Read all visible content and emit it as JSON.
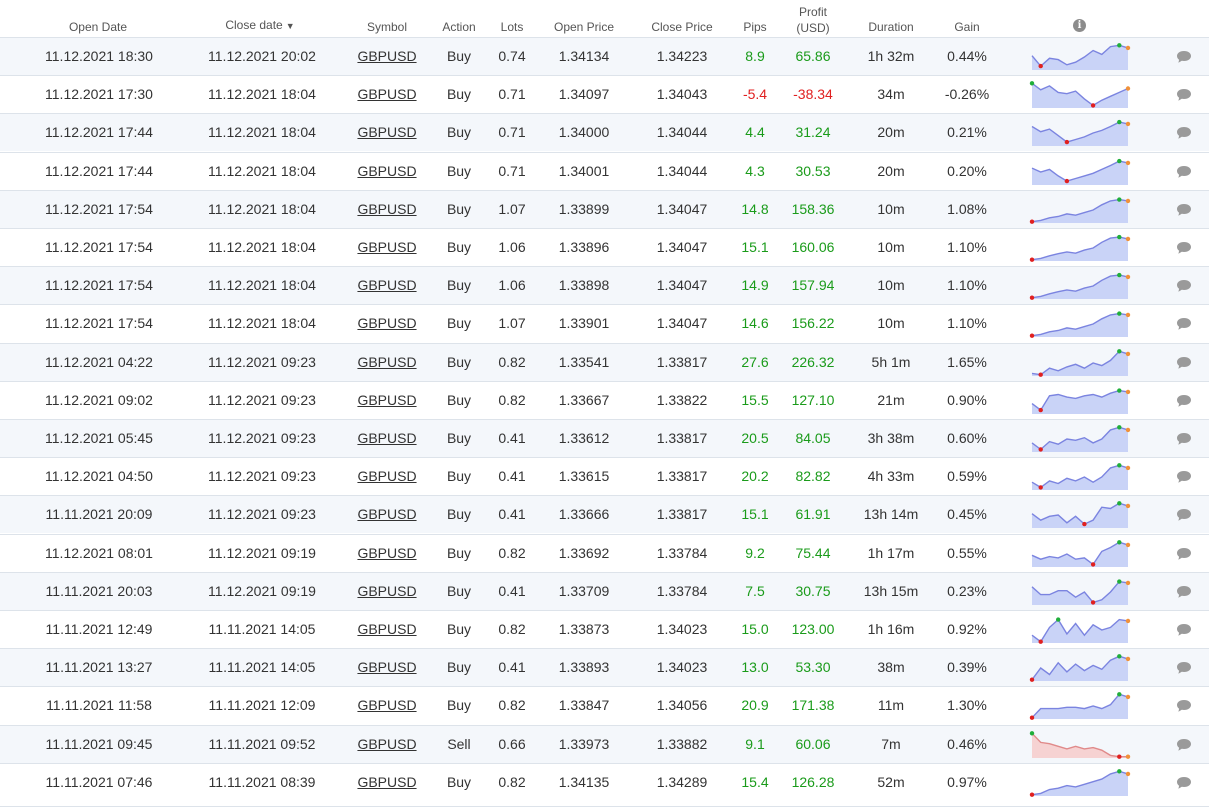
{
  "header": {
    "open_date": "Open Date",
    "close_date": "Close date",
    "sort_arrow": "▼",
    "symbol": "Symbol",
    "action": "Action",
    "lots": "Lots",
    "open_price": "Open Price",
    "close_price": "Close Price",
    "pips": "Pips",
    "profit_line1": "Profit",
    "profit_line2": "(USD)",
    "duration": "Duration",
    "gain": "Gain",
    "info_icon": "i"
  },
  "colors": {
    "positive": "#1a9b1a",
    "negative": "#e02020",
    "spark_line_up": "#7b84e0",
    "spark_fill_up": "#c9d3f7",
    "spark_line_down": "#e08a8a",
    "spark_fill_down": "#f6d2d2",
    "marker_start": "#e02020",
    "marker_max": "#1fae3a",
    "marker_end": "#f0913a"
  },
  "trades": [
    {
      "open_date": "11.12.2021 18:30",
      "close_date": "11.12.2021 20:02",
      "symbol": "GBPUSD",
      "action": "Buy",
      "lots": "0.74",
      "open_price": "1.34134",
      "close_price": "1.34223",
      "pips": "8.9",
      "profit": "65.86",
      "duration": "1h 32m",
      "gain": "0.44%",
      "spark": [
        0.55,
        0.15,
        0.45,
        0.4,
        0.2,
        0.3,
        0.5,
        0.75,
        0.6,
        0.9,
        0.95,
        0.85
      ]
    },
    {
      "open_date": "11.12.2021 17:30",
      "close_date": "11.12.2021 18:04",
      "symbol": "GBPUSD",
      "action": "Buy",
      "lots": "0.71",
      "open_price": "1.34097",
      "close_price": "1.34043",
      "pips": "-5.4",
      "profit": "-38.34",
      "duration": "34m",
      "gain": "-0.26%",
      "spark": [
        0.95,
        0.7,
        0.85,
        0.6,
        0.55,
        0.65,
        0.35,
        0.1,
        0.3,
        0.45,
        0.6,
        0.75
      ]
    },
    {
      "open_date": "11.12.2021 17:44",
      "close_date": "11.12.2021 18:04",
      "symbol": "GBPUSD",
      "action": "Buy",
      "lots": "0.71",
      "open_price": "1.34000",
      "close_price": "1.34044",
      "pips": "4.4",
      "profit": "31.24",
      "duration": "20m",
      "gain": "0.21%",
      "spark": [
        0.75,
        0.55,
        0.65,
        0.4,
        0.15,
        0.25,
        0.35,
        0.5,
        0.6,
        0.75,
        0.92,
        0.85
      ]
    },
    {
      "open_date": "11.12.2021 17:44",
      "close_date": "11.12.2021 18:04",
      "symbol": "GBPUSD",
      "action": "Buy",
      "lots": "0.71",
      "open_price": "1.34001",
      "close_price": "1.34044",
      "pips": "4.3",
      "profit": "30.53",
      "duration": "20m",
      "gain": "0.20%",
      "spark": [
        0.65,
        0.5,
        0.6,
        0.35,
        0.15,
        0.25,
        0.35,
        0.45,
        0.6,
        0.75,
        0.92,
        0.85
      ]
    },
    {
      "open_date": "11.12.2021 17:54",
      "close_date": "11.12.2021 18:04",
      "symbol": "GBPUSD",
      "action": "Buy",
      "lots": "1.07",
      "open_price": "1.33899",
      "close_price": "1.34047",
      "pips": "14.8",
      "profit": "158.36",
      "duration": "10m",
      "gain": "1.08%",
      "spark": [
        0.05,
        0.1,
        0.2,
        0.25,
        0.35,
        0.3,
        0.4,
        0.5,
        0.7,
        0.85,
        0.9,
        0.85
      ]
    },
    {
      "open_date": "11.12.2021 17:54",
      "close_date": "11.12.2021 18:04",
      "symbol": "GBPUSD",
      "action": "Buy",
      "lots": "1.06",
      "open_price": "1.33896",
      "close_price": "1.34047",
      "pips": "15.1",
      "profit": "160.06",
      "duration": "10m",
      "gain": "1.10%",
      "spark": [
        0.05,
        0.1,
        0.2,
        0.28,
        0.35,
        0.3,
        0.42,
        0.5,
        0.72,
        0.88,
        0.92,
        0.85
      ]
    },
    {
      "open_date": "11.12.2021 17:54",
      "close_date": "11.12.2021 18:04",
      "symbol": "GBPUSD",
      "action": "Buy",
      "lots": "1.06",
      "open_price": "1.33898",
      "close_price": "1.34047",
      "pips": "14.9",
      "profit": "157.94",
      "duration": "10m",
      "gain": "1.10%",
      "spark": [
        0.05,
        0.1,
        0.2,
        0.28,
        0.35,
        0.3,
        0.42,
        0.5,
        0.72,
        0.88,
        0.92,
        0.85
      ]
    },
    {
      "open_date": "11.12.2021 17:54",
      "close_date": "11.12.2021 18:04",
      "symbol": "GBPUSD",
      "action": "Buy",
      "lots": "1.07",
      "open_price": "1.33901",
      "close_price": "1.34047",
      "pips": "14.6",
      "profit": "156.22",
      "duration": "10m",
      "gain": "1.10%",
      "spark": [
        0.05,
        0.1,
        0.2,
        0.25,
        0.35,
        0.3,
        0.4,
        0.5,
        0.7,
        0.85,
        0.9,
        0.85
      ]
    },
    {
      "open_date": "11.12.2021 04:22",
      "close_date": "11.12.2021 09:23",
      "symbol": "GBPUSD",
      "action": "Buy",
      "lots": "0.82",
      "open_price": "1.33541",
      "close_price": "1.33817",
      "pips": "27.6",
      "profit": "226.32",
      "duration": "5h 1m",
      "gain": "1.65%",
      "spark": [
        0.1,
        0.05,
        0.3,
        0.2,
        0.35,
        0.45,
        0.3,
        0.5,
        0.4,
        0.6,
        0.95,
        0.85
      ]
    },
    {
      "open_date": "11.12.2021 09:02",
      "close_date": "11.12.2021 09:23",
      "symbol": "GBPUSD",
      "action": "Buy",
      "lots": "0.82",
      "open_price": "1.33667",
      "close_price": "1.33822",
      "pips": "15.5",
      "profit": "127.10",
      "duration": "21m",
      "gain": "0.90%",
      "spark": [
        0.4,
        0.15,
        0.7,
        0.75,
        0.65,
        0.6,
        0.7,
        0.75,
        0.65,
        0.8,
        0.9,
        0.85
      ]
    },
    {
      "open_date": "11.12.2021 05:45",
      "close_date": "11.12.2021 09:23",
      "symbol": "GBPUSD",
      "action": "Buy",
      "lots": "0.41",
      "open_price": "1.33612",
      "close_price": "1.33817",
      "pips": "20.5",
      "profit": "84.05",
      "duration": "3h 38m",
      "gain": "0.60%",
      "spark": [
        0.35,
        0.1,
        0.4,
        0.3,
        0.5,
        0.45,
        0.55,
        0.35,
        0.5,
        0.85,
        0.95,
        0.85
      ]
    },
    {
      "open_date": "11.12.2021 04:50",
      "close_date": "11.12.2021 09:23",
      "symbol": "GBPUSD",
      "action": "Buy",
      "lots": "0.41",
      "open_price": "1.33615",
      "close_price": "1.33817",
      "pips": "20.2",
      "profit": "82.82",
      "duration": "4h 33m",
      "gain": "0.59%",
      "spark": [
        0.3,
        0.1,
        0.35,
        0.25,
        0.45,
        0.35,
        0.5,
        0.3,
        0.5,
        0.85,
        0.95,
        0.85
      ]
    },
    {
      "open_date": "11.11.2021 20:09",
      "close_date": "11.12.2021 09:23",
      "symbol": "GBPUSD",
      "action": "Buy",
      "lots": "0.41",
      "open_price": "1.33666",
      "close_price": "1.33817",
      "pips": "15.1",
      "profit": "61.91",
      "duration": "13h 14m",
      "gain": "0.45%",
      "spark": [
        0.55,
        0.3,
        0.45,
        0.5,
        0.2,
        0.45,
        0.15,
        0.3,
        0.8,
        0.75,
        0.95,
        0.85
      ]
    },
    {
      "open_date": "11.12.2021 08:01",
      "close_date": "11.12.2021 09:19",
      "symbol": "GBPUSD",
      "action": "Buy",
      "lots": "0.82",
      "open_price": "1.33692",
      "close_price": "1.33784",
      "pips": "9.2",
      "profit": "75.44",
      "duration": "1h 17m",
      "gain": "0.55%",
      "spark": [
        0.45,
        0.3,
        0.4,
        0.35,
        0.5,
        0.3,
        0.35,
        0.1,
        0.6,
        0.75,
        0.95,
        0.85
      ]
    },
    {
      "open_date": "11.11.2021 20:03",
      "close_date": "11.12.2021 09:19",
      "symbol": "GBPUSD",
      "action": "Buy",
      "lots": "0.41",
      "open_price": "1.33709",
      "close_price": "1.33784",
      "pips": "7.5",
      "profit": "30.75",
      "duration": "13h 15m",
      "gain": "0.23%",
      "spark": [
        0.7,
        0.4,
        0.4,
        0.55,
        0.55,
        0.3,
        0.5,
        0.1,
        0.2,
        0.5,
        0.9,
        0.85
      ]
    },
    {
      "open_date": "11.11.2021 12:49",
      "close_date": "11.11.2021 14:05",
      "symbol": "GBPUSD",
      "action": "Buy",
      "lots": "0.82",
      "open_price": "1.33873",
      "close_price": "1.34023",
      "pips": "15.0",
      "profit": "123.00",
      "duration": "1h 16m",
      "gain": "0.92%",
      "spark": [
        0.3,
        0.05,
        0.6,
        0.9,
        0.35,
        0.75,
        0.3,
        0.7,
        0.5,
        0.6,
        0.9,
        0.85
      ]
    },
    {
      "open_date": "11.11.2021 13:27",
      "close_date": "11.11.2021 14:05",
      "symbol": "GBPUSD",
      "action": "Buy",
      "lots": "0.41",
      "open_price": "1.33893",
      "close_price": "1.34023",
      "pips": "13.0",
      "profit": "53.30",
      "duration": "38m",
      "gain": "0.39%",
      "spark": [
        0.05,
        0.5,
        0.25,
        0.7,
        0.35,
        0.65,
        0.4,
        0.6,
        0.45,
        0.8,
        0.95,
        0.85
      ]
    },
    {
      "open_date": "11.11.2021 11:58",
      "close_date": "11.11.2021 12:09",
      "symbol": "GBPUSD",
      "action": "Buy",
      "lots": "0.82",
      "open_price": "1.33847",
      "close_price": "1.34056",
      "pips": "20.9",
      "profit": "171.38",
      "duration": "11m",
      "gain": "1.30%",
      "spark": [
        0.05,
        0.4,
        0.4,
        0.4,
        0.45,
        0.45,
        0.4,
        0.5,
        0.4,
        0.55,
        0.95,
        0.85
      ]
    },
    {
      "open_date": "11.11.2021 09:45",
      "close_date": "11.11.2021 09:52",
      "symbol": "GBPUSD",
      "action": "Sell",
      "lots": "0.66",
      "open_price": "1.33973",
      "close_price": "1.33882",
      "pips": "9.1",
      "profit": "60.06",
      "duration": "7m",
      "gain": "0.46%",
      "spark": [
        0.95,
        0.6,
        0.55,
        0.45,
        0.35,
        0.45,
        0.35,
        0.4,
        0.3,
        0.1,
        0.05,
        0.05
      ]
    },
    {
      "open_date": "11.11.2021 07:46",
      "close_date": "11.11.2021 08:39",
      "symbol": "GBPUSD",
      "action": "Buy",
      "lots": "0.82",
      "open_price": "1.34135",
      "close_price": "1.34289",
      "pips": "15.4",
      "profit": "126.28",
      "duration": "52m",
      "gain": "0.97%",
      "spark": [
        0.05,
        0.1,
        0.25,
        0.3,
        0.4,
        0.35,
        0.45,
        0.55,
        0.65,
        0.85,
        0.95,
        0.85
      ]
    }
  ]
}
